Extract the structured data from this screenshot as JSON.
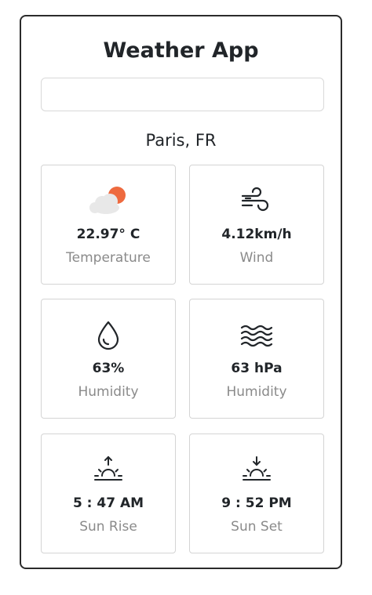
{
  "app": {
    "title": "Weather App",
    "search_value": "",
    "location": "Paris, FR"
  },
  "tiles": [
    {
      "value": "22.97° C",
      "label": "Temperature",
      "icon": "partly-cloudy-icon"
    },
    {
      "value": "4.12km/h",
      "label": "Wind",
      "icon": "wind-icon"
    },
    {
      "value": "63%",
      "label": "Humidity",
      "icon": "droplet-icon"
    },
    {
      "value": "63 hPa",
      "label": "Humidity",
      "icon": "pressure-waves-icon"
    },
    {
      "value": "5 : 47 AM",
      "label": "Sun Rise",
      "icon": "sunrise-icon"
    },
    {
      "value": "9 : 52 PM",
      "label": "Sun Set",
      "icon": "sunset-icon"
    }
  ],
  "colors": {
    "sun": "#ee6a3f",
    "cloud": "#e8e8e8",
    "border": "#d4d4d4",
    "text": "#212529",
    "muted": "#8a8a8a"
  }
}
